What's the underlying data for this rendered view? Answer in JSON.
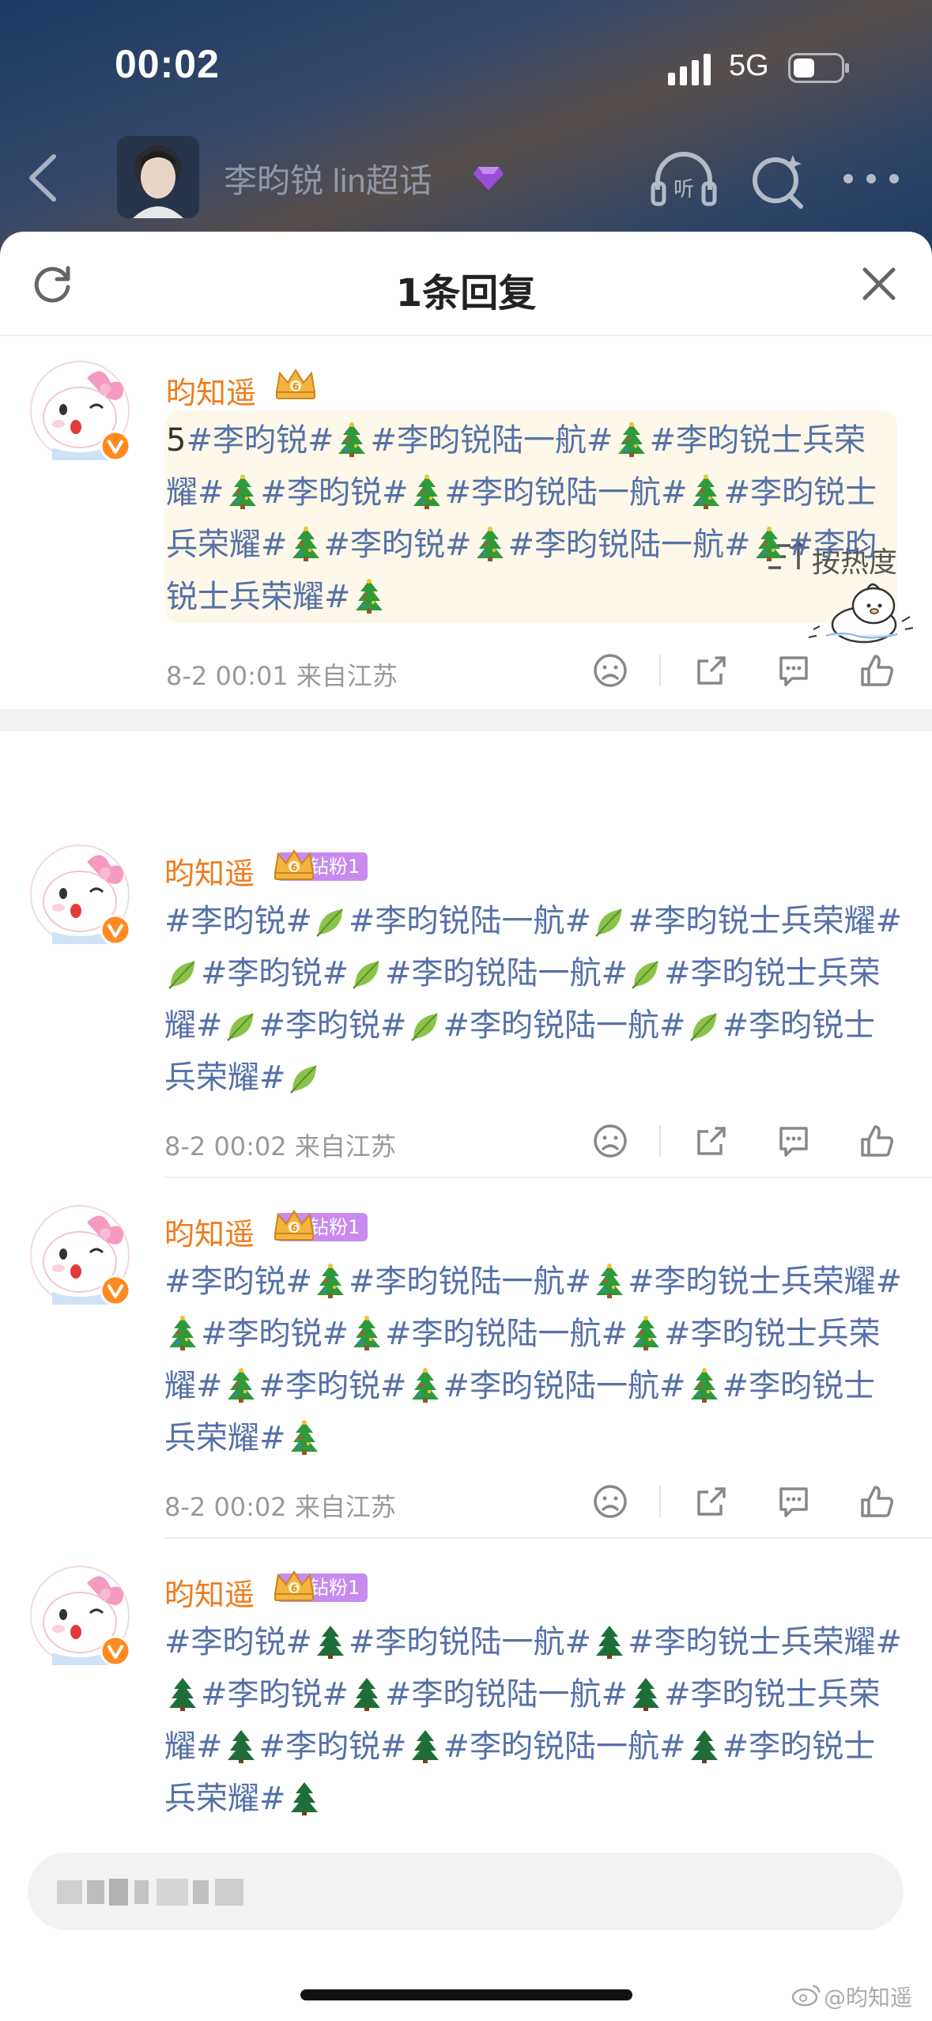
{
  "status_bar": {
    "time": "00:02",
    "network": "5G"
  },
  "header": {
    "title": "李昀锐 lin超话"
  },
  "sheet": {
    "title": "1条回复"
  },
  "main_comment": {
    "username": "昀知遥",
    "lead": "5",
    "segments": [
      "#李昀锐#",
      "#李昀锐陆一航#",
      "#李昀锐士兵荣耀#",
      "#李昀锐#",
      "#李昀锐陆一航#",
      "#李昀锐士兵荣耀#",
      "#李昀锐#",
      "#李昀锐陆一航#",
      "#李昀锐士兵荣耀#"
    ],
    "emoji": "christmas-tree",
    "timestamp": "8-2 00:01",
    "location": "来自江苏"
  },
  "sort": {
    "label": "按热度"
  },
  "replies": [
    {
      "username": "昀知遥",
      "badge": "钻粉1",
      "segments": [
        "#李昀锐#",
        "#李昀锐陆一航#",
        "#李昀锐士兵荣耀#",
        "#李昀锐#",
        "#李昀锐陆一航#",
        "#李昀锐士兵荣耀#",
        "#李昀锐#",
        "#李昀锐陆一航#",
        "#李昀锐士兵荣耀#"
      ],
      "emoji": "leaf",
      "timestamp": "8-2 00:02",
      "location": "来自江苏"
    },
    {
      "username": "昀知遥",
      "badge": "钻粉1",
      "segments": [
        "#李昀锐#",
        "#李昀锐陆一航#",
        "#李昀锐士兵荣耀#",
        "#李昀锐#",
        "#李昀锐陆一航#",
        "#李昀锐士兵荣耀#",
        "#李昀锐#",
        "#李昀锐陆一航#",
        "#李昀锐士兵荣耀#"
      ],
      "emoji": "christmas-tree",
      "timestamp": "8-2 00:02",
      "location": "来自江苏"
    },
    {
      "username": "昀知遥",
      "badge": "钻粉1",
      "segments": [
        "#李昀锐#",
        "#李昀锐陆一航#",
        "#李昀锐士兵荣耀#",
        "#李昀锐#",
        "#李昀锐陆一航#",
        "#李昀锐士兵荣耀#",
        "#李昀锐#",
        "#李昀锐陆一航#",
        "#李昀锐士兵荣耀#"
      ],
      "emoji": "evergreen-tree",
      "timestamp": "",
      "location": ""
    }
  ],
  "watermark": {
    "text": "@昀知遥"
  },
  "colors": {
    "username": "#f07c1c",
    "topic": "#5671a8",
    "badge": "#c98aee",
    "meta": "#999999"
  }
}
